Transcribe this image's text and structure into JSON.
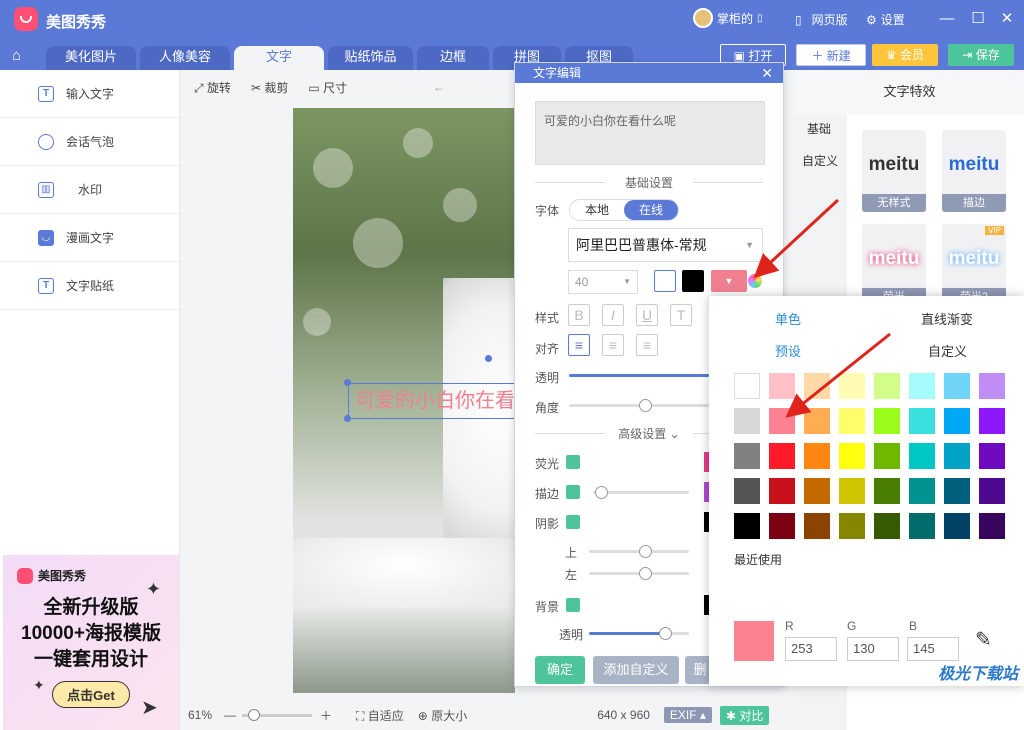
{
  "app": {
    "title": "美图秀秀"
  },
  "titlebar": {
    "user": "掌柜的",
    "web": "网页版",
    "settings": "设置"
  },
  "tabs": [
    "美化图片",
    "人像美容",
    "文字",
    "贴纸饰品",
    "边框",
    "拼图",
    "抠图"
  ],
  "actions": {
    "open": "打开",
    "new": "新建",
    "vip": "会员",
    "save": "保存"
  },
  "sidebar": {
    "items": [
      "输入文字",
      "会话气泡",
      "水印",
      "漫画文字",
      "文字贴纸"
    ]
  },
  "ad": {
    "brand": "美图秀秀",
    "line1": "全新升级版",
    "line2": "10000+海报模版",
    "line3": "一键套用设计",
    "cta": "点击Get"
  },
  "toolbar": {
    "rotate": "旋转",
    "crop": "裁剪",
    "size": "尺寸"
  },
  "canvas": {
    "text": "可爱的小白你在看什么呢"
  },
  "status": {
    "zoom": "61%",
    "fit": "自适应",
    "original": "原大小",
    "dims": "640 x 960",
    "exif": "EXIF",
    "compare": "对比"
  },
  "dialog": {
    "title": "文字编辑",
    "input": "可爱的小白你在看什么呢",
    "basic": "基础设置",
    "font_label": "字体",
    "local": "本地",
    "online": "在线",
    "font_name": "阿里巴巴普惠体-常规",
    "size": "40",
    "style_label": "样式",
    "align_label": "对齐",
    "opacity_label": "透明",
    "angle_label": "角度",
    "advanced": "高级设置",
    "glow": "荧光",
    "stroke": "描边",
    "shadow": "阴影",
    "up": "上",
    "left": "左",
    "bg": "背景",
    "bg_opacity": "透明",
    "confirm": "确定",
    "add_custom": "添加自定义",
    "delete": "删",
    "text_color": "#f08090"
  },
  "effects": {
    "title": "文字特效",
    "tabs": [
      "基础",
      "自定义"
    ],
    "items": [
      {
        "text": "meitu",
        "caption": "无样式"
      },
      {
        "text": "meitu",
        "caption": "描边"
      },
      {
        "text": "meitu",
        "caption": "荧光"
      },
      {
        "text": "meitu",
        "caption": "荧光2"
      }
    ],
    "vip": "VIP"
  },
  "picker": {
    "tabs": [
      "单色",
      "直线渐变",
      "预设",
      "自定义"
    ],
    "recent": "最近使用",
    "r_label": "R",
    "g_label": "G",
    "b_label": "B",
    "r": "253",
    "g": "130",
    "b": "145",
    "current": "#fd8291",
    "swatches": [
      [
        "#ffffff",
        "#ffc0c8",
        "#ffd9a6",
        "#fffbb3",
        "#d2fd8a",
        "#a6fcfc",
        "#70d3f8",
        "#c08cf6"
      ],
      [
        "#d8d8d8",
        "#fd8291",
        "#ffad55",
        "#fffe6a",
        "#9cfd1d",
        "#3ae0de",
        "#00a8f6",
        "#8f17fb"
      ],
      [
        "#808080",
        "#ff1a2a",
        "#ff8612",
        "#ffff0d",
        "#6fb800",
        "#00c7c4",
        "#00a3c5",
        "#6f0abf"
      ],
      [
        "#555555",
        "#c8101b",
        "#c46800",
        "#d0c400",
        "#4a7e00",
        "#009391",
        "#00607e",
        "#4e0a8e"
      ],
      [
        "#000000",
        "#7a0012",
        "#8a4400",
        "#868700",
        "#355a00",
        "#006d6c",
        "#004266",
        "#38045e"
      ]
    ]
  },
  "watermark": "极光下载站"
}
